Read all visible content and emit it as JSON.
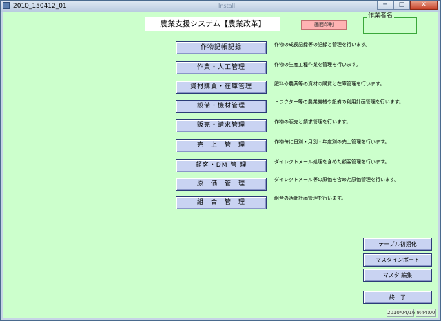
{
  "window": {
    "title": "2010_150412_01",
    "ghost_title": "Install",
    "minimize": "─",
    "maximize": "□",
    "close": "✕"
  },
  "header": {
    "app_title": "農業支援システム【農業改革】",
    "print_button": "画面印刷",
    "worker_label": "作業者名",
    "worker_name": ""
  },
  "menu": [
    {
      "label": "作物記帳記録",
      "desc": "作物の成長記録等の記録と管理を行います。"
    },
    {
      "label": "作業・人工管理",
      "desc": "作物の生産工程作業を管理を行います。"
    },
    {
      "label": "資材購買・在庫管理",
      "desc": "肥料や農薬等の資材の購買と在庫管理を行います。"
    },
    {
      "label": "設備・機材管理",
      "desc": "トラクター等の農業機械や設備の利用計画管理を行います。"
    },
    {
      "label": "販売・請求管理",
      "desc": "作物の販売と請求管理を行います。"
    },
    {
      "label": "売　上　管　理",
      "desc": "作物毎に日別・月別・年度別の売上管理を行います。"
    },
    {
      "label": "顧客・DM 管 理",
      "desc": "ダイレクトメール処理を含めた顧客管理を行います。"
    },
    {
      "label": "原　価　管　理",
      "desc": "ダイレクトメール等の原価を含めた原価管理を行います。"
    },
    {
      "label": "組　合　管　理",
      "desc": "組合の活動計画管理を行います。"
    }
  ],
  "side": {
    "table_init": "テーブル初期化",
    "master_import": "マスタインポート",
    "master_edit": "マスタ 編集",
    "exit": "終　了"
  },
  "status": {
    "date": "2010/04/16",
    "time": "9:44:00"
  }
}
